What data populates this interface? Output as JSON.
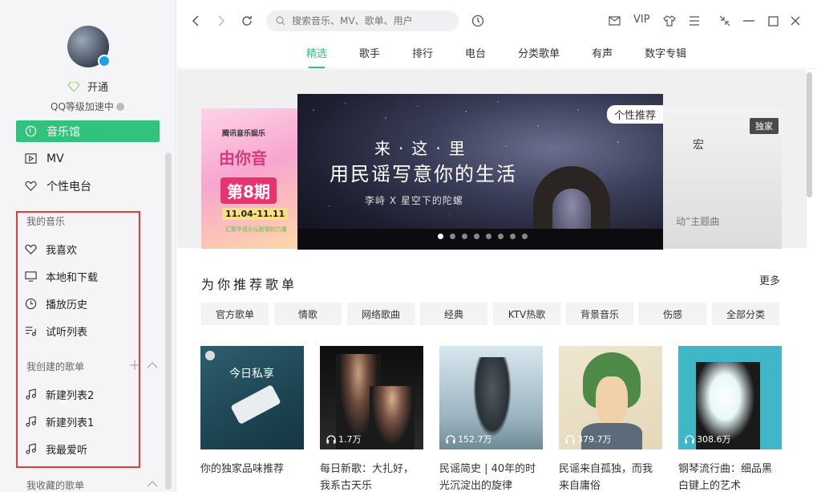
{
  "sidebar": {
    "vip_label": "开通",
    "qq_level": "QQ等级加速中",
    "nav": [
      {
        "label": "音乐馆",
        "icon": "music-hall-icon",
        "active": true
      },
      {
        "label": "MV",
        "icon": "mv-icon",
        "active": false
      },
      {
        "label": "个性电台",
        "icon": "radio-heart-icon",
        "active": false
      }
    ],
    "my_music_title": "我的音乐",
    "my_music": [
      {
        "label": "我喜欢",
        "icon": "heart-icon"
      },
      {
        "label": "本地和下载",
        "icon": "monitor-icon"
      },
      {
        "label": "播放历史",
        "icon": "clock-icon"
      },
      {
        "label": "试听列表",
        "icon": "playlist-icon"
      }
    ],
    "created_title": "我创建的歌单",
    "created": [
      {
        "label": "新建列表2",
        "icon": "note-icon"
      },
      {
        "label": "新建列表1",
        "icon": "note-icon"
      },
      {
        "label": "我最爱听",
        "icon": "note-icon"
      }
    ],
    "collected_title": "我收藏的歌单"
  },
  "topbar": {
    "search_placeholder": "搜索音乐、MV、歌单、用户",
    "vip": "VIP",
    "tabs": [
      "精选",
      "歌手",
      "排行",
      "电台",
      "分类歌单",
      "有声",
      "数字专辑"
    ],
    "active_tab": "精选"
  },
  "banner": {
    "left": {
      "logo": "腾讯音乐娱乐",
      "title": "由你音",
      "issue": "第8期",
      "date": "11.04-11.11",
      "note": "汇聚华语乐坛新歌的力量"
    },
    "center": {
      "tag": "个性推荐",
      "line1": "来·这·里",
      "line2": "用民谣写意你的生活",
      "line3": "李峙 X 星空下的陀螺"
    },
    "right": {
      "tag": "独家",
      "text1": "宏",
      "text2": "动”主题曲"
    },
    "dot_count": 8,
    "active_dot": 0
  },
  "recommend": {
    "title": "为你推荐歌单",
    "more": "更多",
    "chips": [
      "官方歌单",
      "情歌",
      "网络歌曲",
      "经典",
      "KTV热歌",
      "背景音乐",
      "伤感",
      "全部分类"
    ],
    "cards": [
      {
        "cover_text": "今日私享",
        "plays": "",
        "title": "你的独家品味推荐"
      },
      {
        "cover_text": "",
        "plays": "1.7万",
        "title": "每日新歌：大扎好，我系古天乐"
      },
      {
        "cover_text": "",
        "plays": "152.7万",
        "title": "民谣简史 | 40年的时光沉淀出的旋律"
      },
      {
        "cover_text": "",
        "plays": "379.7万",
        "title": "民谣来自孤独，而我来自庸俗"
      },
      {
        "cover_text": "",
        "plays": "308.6万",
        "title": "钢琴流行曲：细品黑白键上的艺术"
      }
    ]
  },
  "colors": {
    "accent": "#31c27c",
    "highlight_box": "#e83a3a"
  }
}
